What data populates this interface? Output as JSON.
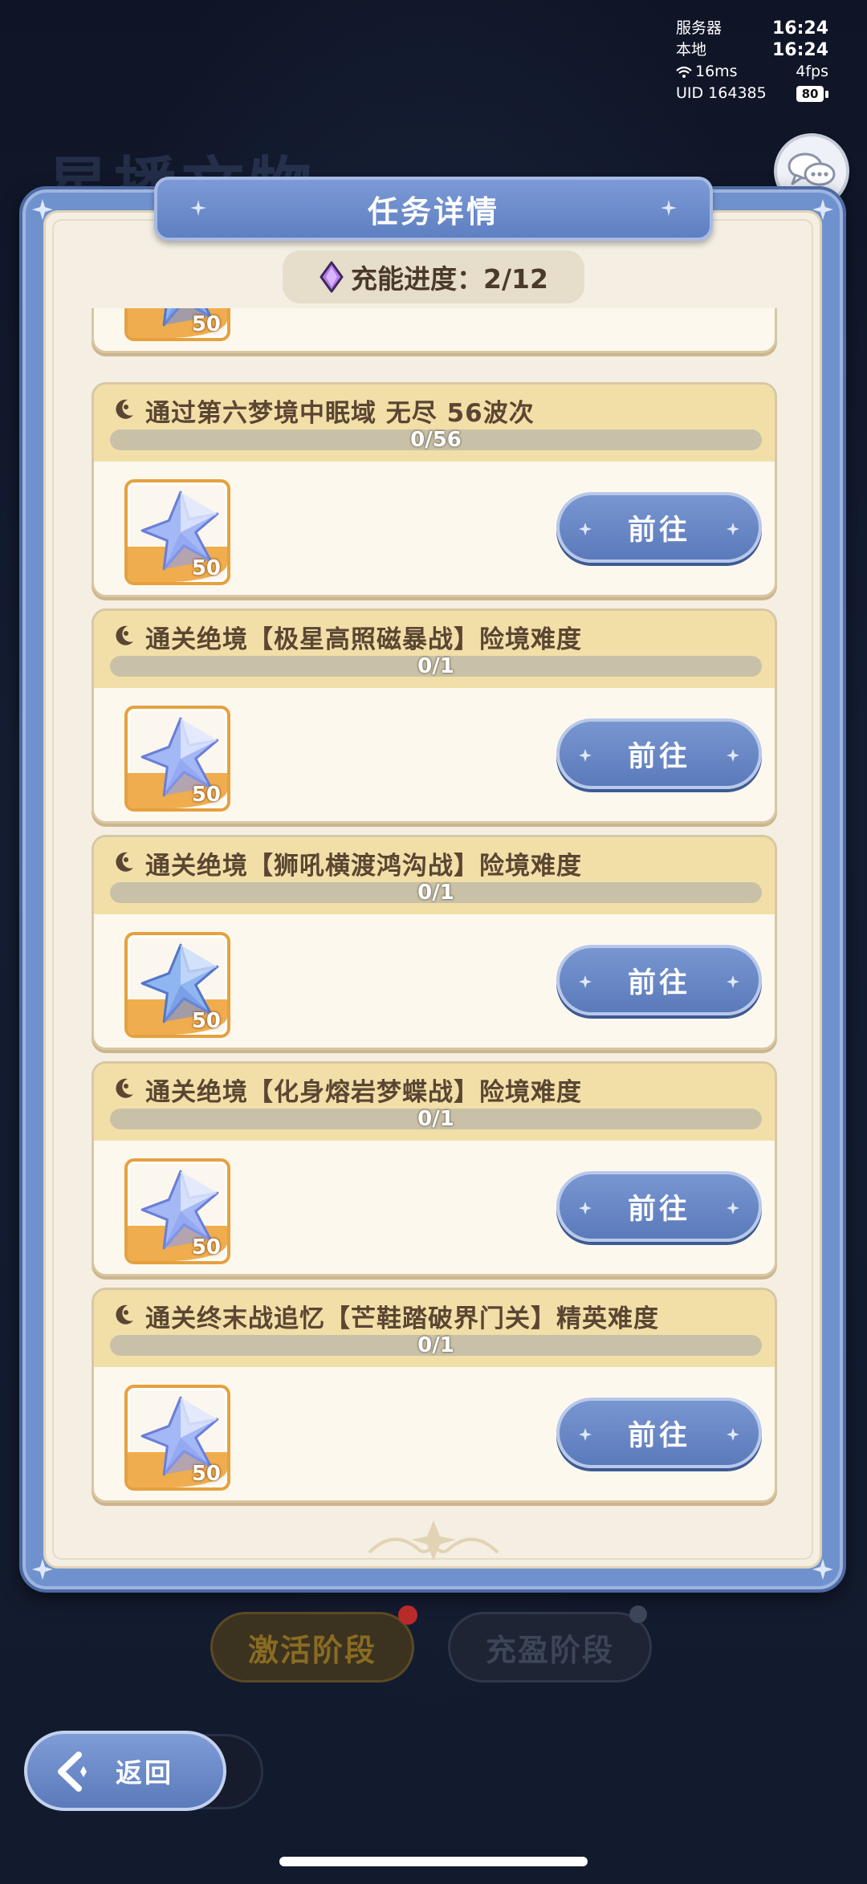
{
  "status": {
    "server_label": "服务器",
    "server_time": "16:24",
    "local_label": "本地",
    "local_time": "16:24",
    "ping": "16ms",
    "fps": "4fps",
    "uid_label": "UID 164385",
    "battery": "80"
  },
  "background_title": "星播文物",
  "panel": {
    "title": "任务详情",
    "progress_label": "充能进度：2/12"
  },
  "tasks": [
    {
      "title": "",
      "progress": "",
      "reward_count": "50",
      "button": "前往"
    },
    {
      "title": "通过第六梦境中眠域 无尽 56波次",
      "progress": "0/56",
      "fraction": 0,
      "reward_count": "50",
      "button": "前往"
    },
    {
      "title": "通关绝境【极星高照磁暴战】险境难度",
      "progress": "0/1",
      "fraction": 0,
      "reward_count": "50",
      "button": "前往"
    },
    {
      "title": "通关绝境【狮吼横渡鸿沟战】险境难度",
      "progress": "0/1",
      "fraction": 0,
      "reward_count": "50",
      "button": "前往"
    },
    {
      "title": "通关绝境【化身熔岩梦蝶战】险境难度",
      "progress": "0/1",
      "fraction": 0,
      "reward_count": "50",
      "button": "前往"
    },
    {
      "title": "通关终末战追忆【芒鞋踏破界门关】精英难度",
      "progress": "0/1",
      "fraction": 0,
      "reward_count": "50",
      "button": "前往"
    }
  ],
  "stages": {
    "activate": "激活阶段",
    "fill": "充盈阶段"
  },
  "back_label": "返回",
  "colors": {
    "panel_blue": "#6f92cf",
    "card_header": "#f2dfa8",
    "button_blue": "#5b7abb",
    "reward_orange": "#f0ad4e"
  }
}
